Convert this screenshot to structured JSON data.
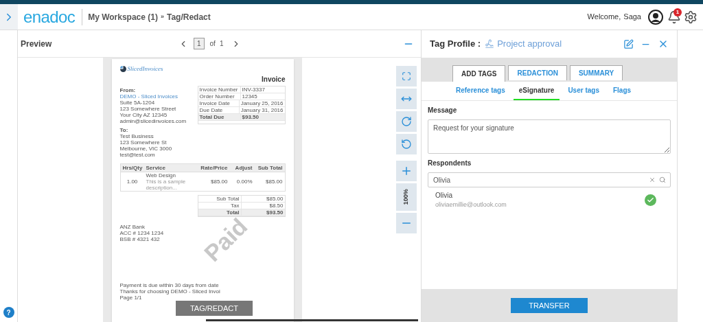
{
  "header": {
    "logo": "enadoc",
    "breadcrumb": [
      {
        "label": "My Workspace (1)"
      },
      {
        "label": "Tag/Redact"
      }
    ],
    "separator": "»",
    "welcome": "Welcome,",
    "user": "Saga",
    "notifications": "1"
  },
  "preview": {
    "title": "Preview",
    "page": "1",
    "of": "of",
    "total": "1",
    "zoom": "100%",
    "action": "TAG/REDACT"
  },
  "invoice": {
    "brand": "SlicedInvoices",
    "title": "Invoice",
    "from_label": "From:",
    "from_lines": [
      {
        "text": "DEMO - Sliced Invoices",
        "link": true
      },
      {
        "text": "Suite 5A-1204",
        "link": false
      },
      {
        "text": "123 Somewhere Street",
        "link": false
      },
      {
        "text": "Your City AZ 12345",
        "link": false
      },
      {
        "text": "admin@slicedinvoices.com",
        "link": false
      }
    ],
    "info": [
      {
        "label": "Invoice Number",
        "value": "INV-3337",
        "bold": false
      },
      {
        "label": "Order Number",
        "value": "12345",
        "bold": false
      },
      {
        "label": "Invoice Date",
        "value": "January 25, 2016",
        "bold": false
      },
      {
        "label": "Due Date",
        "value": "January 31, 2016",
        "bold": false
      },
      {
        "label": "Total Due",
        "value": "$93.50",
        "bold": true
      }
    ],
    "to_label": "To:",
    "to_lines": [
      "Test Business",
      "123 Somewhere St",
      "Melbourne, VIC 3000",
      "test@test.com"
    ],
    "columns": [
      "Hrs/Qty",
      "Service",
      "Rate/Price",
      "Adjust",
      "Sub Total"
    ],
    "items": [
      {
        "qty": "1.00",
        "service": "Web Design",
        "description": "This is a sample description...",
        "rate": "$85.00",
        "adjust": "0.00%",
        "subtotal": "$85.00"
      }
    ],
    "totals": [
      {
        "label": "Sub Total",
        "value": "$85.00",
        "bold": false
      },
      {
        "label": "Tax",
        "value": "$8.50",
        "bold": false
      },
      {
        "label": "Total",
        "value": "$93.50",
        "bold": true
      }
    ],
    "stamp": "Paid",
    "bank_lines": [
      "ANZ Bank",
      "ACC # 1234 1234",
      "BSB # 4321 432"
    ],
    "footer_lines": [
      "Payment is due within 30 days from date",
      "Thanks for choosing DEMO - Sliced Invoi",
      "Page 1/1"
    ]
  },
  "help": "?",
  "tag_profile": {
    "label": "Tag Profile :",
    "name": "Project approval",
    "tabs": [
      {
        "label": "ADD TAGS",
        "selected": true
      },
      {
        "label": "REDACTION",
        "selected": false
      },
      {
        "label": "SUMMARY",
        "selected": false
      }
    ],
    "subtabs": [
      {
        "label": "Reference tags",
        "selected": false
      },
      {
        "label": "eSignature",
        "selected": true
      },
      {
        "label": "User tags",
        "selected": false
      },
      {
        "label": "Flags",
        "selected": false
      }
    ],
    "message_label": "Message",
    "message": "Request for your signature",
    "respondents_label": "Respondents",
    "search": "Olivia",
    "results": [
      {
        "name": "Olivia",
        "email": "oliviaemillie@outlook.com",
        "checked": true
      }
    ],
    "action": "TRANSFER"
  }
}
